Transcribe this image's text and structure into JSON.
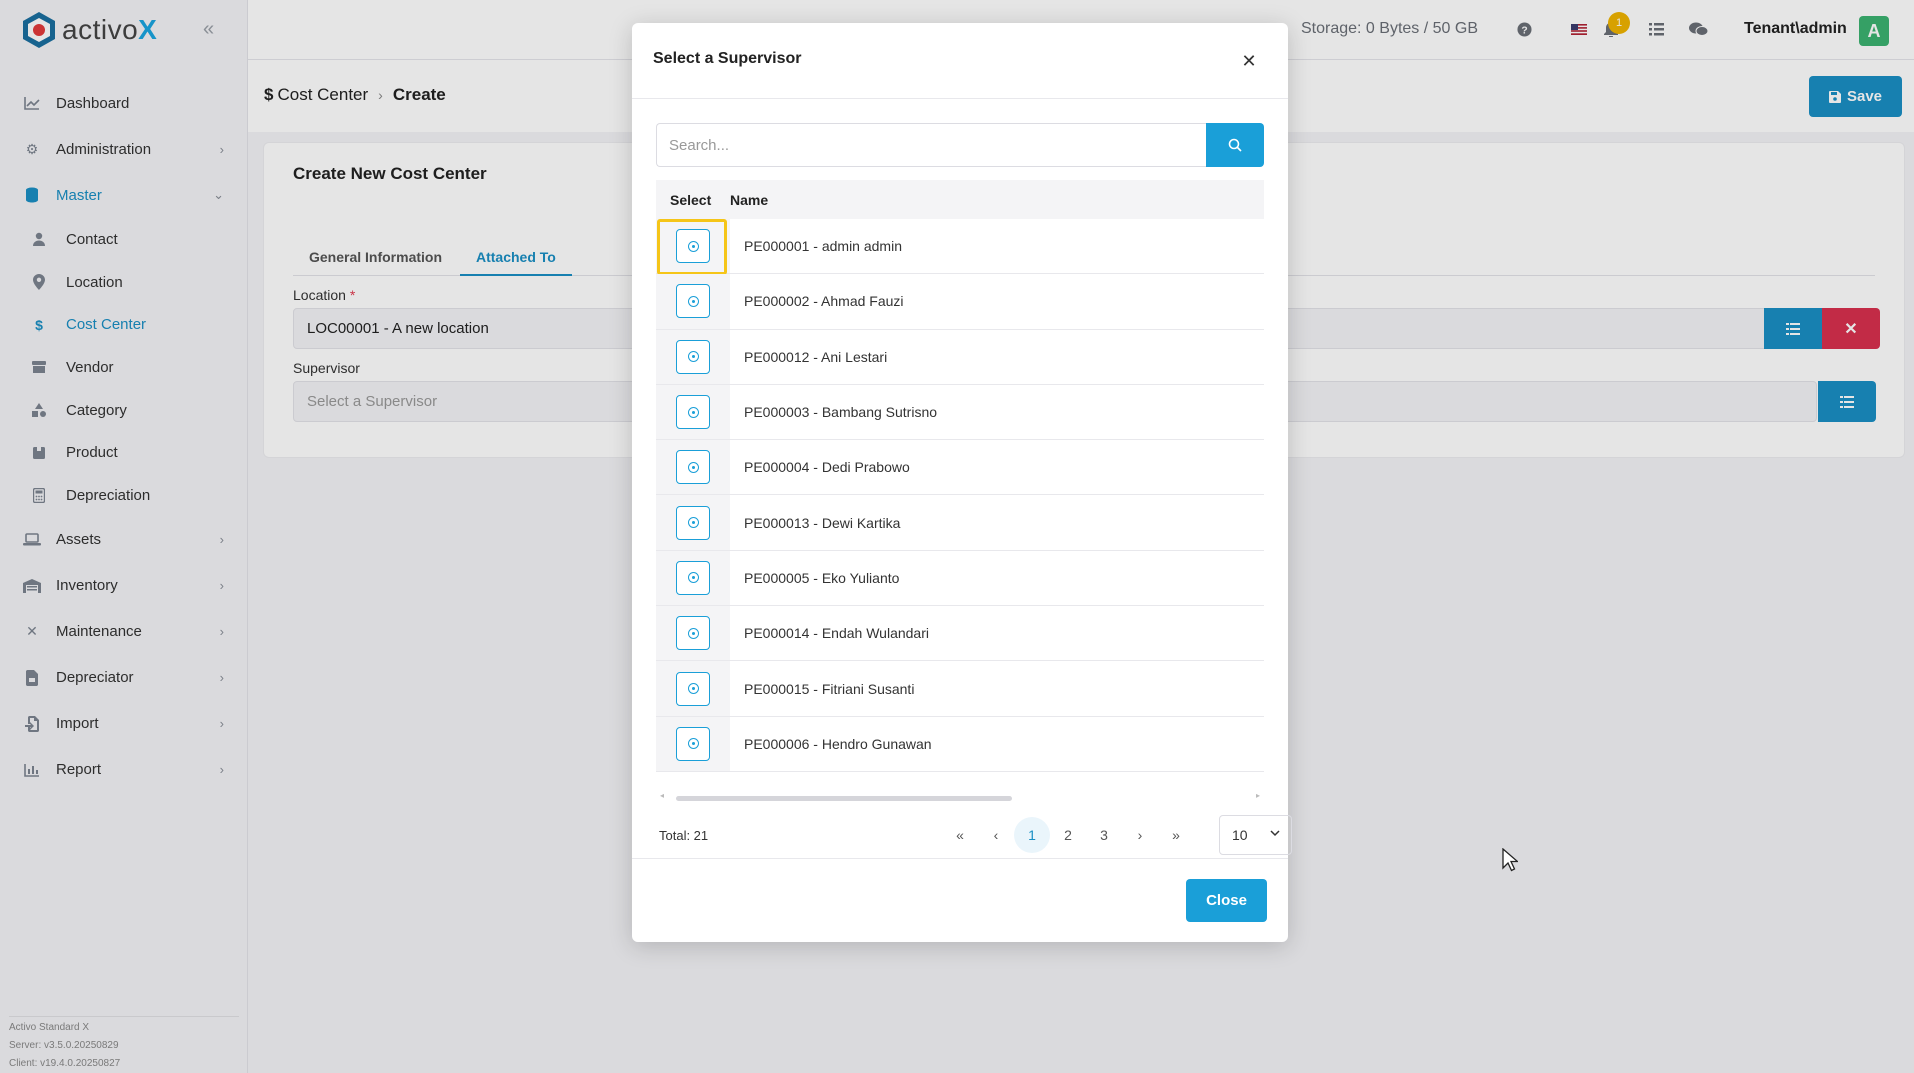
{
  "app": {
    "logo_prefix": "activo",
    "logo_suffix": "X"
  },
  "sidebar": {
    "items": [
      {
        "label": "Dashboard",
        "icon": "chart-line-icon"
      },
      {
        "label": "Administration",
        "icon": "gears-icon"
      },
      {
        "label": "Master",
        "icon": "database-icon"
      },
      {
        "label": "Assets",
        "icon": "laptop-icon"
      },
      {
        "label": "Inventory",
        "icon": "warehouse-icon"
      },
      {
        "label": "Maintenance",
        "icon": "tools-icon"
      },
      {
        "label": "Depreciator",
        "icon": "file-invoice-icon"
      },
      {
        "label": "Import",
        "icon": "file-import-icon"
      },
      {
        "label": "Report",
        "icon": "chart-bar-icon"
      }
    ],
    "master_sub": [
      {
        "label": "Contact"
      },
      {
        "label": "Location"
      },
      {
        "label": "Cost Center"
      },
      {
        "label": "Vendor"
      },
      {
        "label": "Category"
      },
      {
        "label": "Product"
      },
      {
        "label": "Depreciation"
      }
    ],
    "version": {
      "line1": "Activo Standard X",
      "line2": "Server: v3.5.0.20250829",
      "line3": "Client: v19.4.0.20250827"
    }
  },
  "topbar": {
    "storage": "Storage: 0 Bytes / 50 GB",
    "notif_count": "1",
    "user": "Tenant\\admin",
    "avatar_letter": "A"
  },
  "page": {
    "breadcrumb_root": "Cost Center",
    "breadcrumb_current": "Create",
    "save_label": "Save",
    "card_title": "Create New Cost Center",
    "tabs": [
      "General Information",
      "Attached To"
    ],
    "location_label": "Location",
    "location_value": "LOC00001 - A new location",
    "supervisor_label": "Supervisor",
    "supervisor_placeholder": "Select a Supervisor"
  },
  "modal": {
    "title": "Select a Supervisor",
    "search_placeholder": "Search...",
    "col_select": "Select",
    "col_name": "Name",
    "rows": [
      "PE000001 - admin admin",
      "PE000002 - Ahmad Fauzi",
      "PE000012 - Ani Lestari",
      "PE000003 - Bambang Sutrisno",
      "PE000004 - Dedi Prabowo",
      "PE000013 - Dewi Kartika",
      "PE000005 - Eko Yulianto",
      "PE000014 - Endah Wulandari",
      "PE000015 - Fitriani Susanti",
      "PE000006 - Hendro Gunawan"
    ],
    "total": "Total: 21",
    "pages": [
      "1",
      "2",
      "3"
    ],
    "page_size": "10",
    "close_label": "Close"
  }
}
